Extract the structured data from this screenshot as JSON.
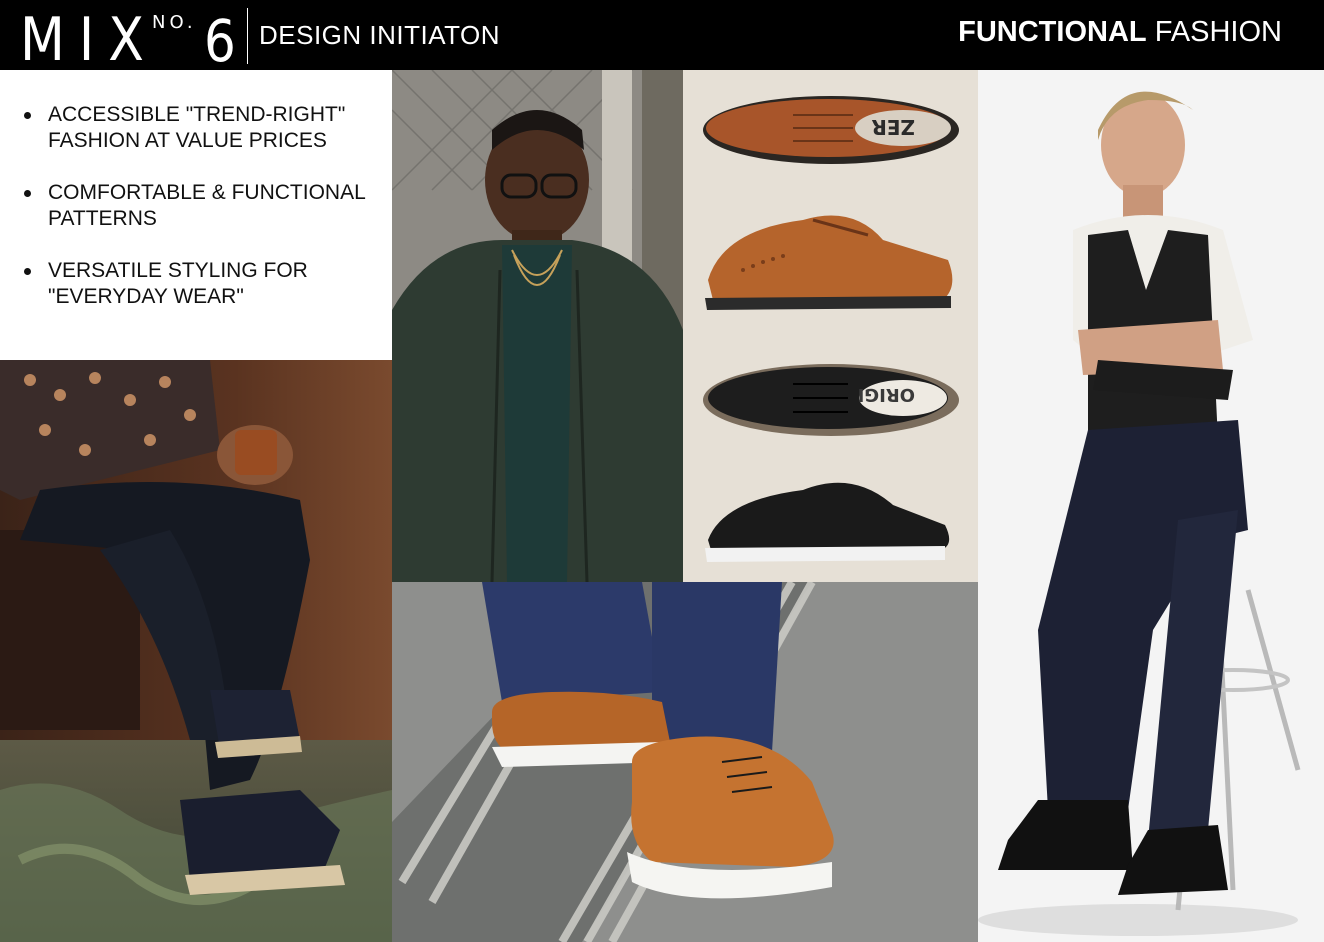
{
  "header": {
    "logo_mix": "MIX",
    "logo_no": "NO.",
    "logo_num": "6",
    "subtitle": "DESIGN INITIATON",
    "headline_bold": "FUNCTIONAL",
    "headline_light": "FASHION"
  },
  "bullets": [
    "ACCESSIBLE \"TREND-RIGHT\" FASHION AT VALUE PRICES",
    "COMFORTABLE & FUNCTIONAL PATTERNS",
    "VERSATILE STYLING FOR \"EVERYDAY WEAR\""
  ],
  "shoe_labels": {
    "top": "ZER",
    "third": "ORIGI"
  },
  "colors": {
    "header_bg": "#000000",
    "header_text": "#ffffff",
    "tan_leather": "#b5642c",
    "black_leather": "#1b1b1b",
    "navy_denim": "#1e2438"
  }
}
